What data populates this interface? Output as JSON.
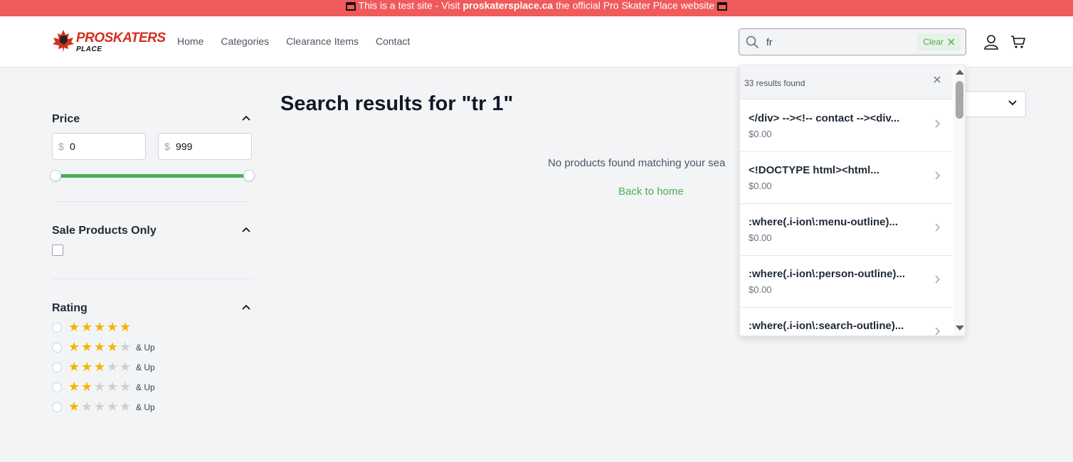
{
  "banner": {
    "prefix": "This is a test site - Visit ",
    "site": "proskatersplace.ca",
    "suffix": " the official Pro Skater Place website"
  },
  "brand": {
    "name": "PROSKATERS",
    "sub": "PLACE"
  },
  "nav": [
    "Home",
    "Categories",
    "Clearance Items",
    "Contact"
  ],
  "search": {
    "value": "fr",
    "clear_label": "Clear"
  },
  "filters": {
    "price": {
      "title": "Price",
      "currency": "$",
      "min": "0",
      "max": "999",
      "range_fraction": [
        0,
        1
      ]
    },
    "sale": {
      "title": "Sale Products Only",
      "checked": false
    },
    "rating": {
      "title": "Rating",
      "options": [
        {
          "stars": 5,
          "suffix": ""
        },
        {
          "stars": 4,
          "suffix": "& Up"
        },
        {
          "stars": 3,
          "suffix": "& Up"
        },
        {
          "stars": 2,
          "suffix": "& Up"
        },
        {
          "stars": 1,
          "suffix": "& Up"
        }
      ]
    }
  },
  "main": {
    "title": "Search results for \"tr 1\"",
    "empty_text": "No products found matching your sea",
    "back_link": "Back to home"
  },
  "dropdown": {
    "count": "33 results found",
    "results": [
      {
        "name": "</div> --><!-- contact --><div...",
        "price": "$0.00"
      },
      {
        "name": "<!DOCTYPE html><html...",
        "price": "$0.00"
      },
      {
        "name": ":where(.i-ion\\:menu-outline)...",
        "price": "$0.00"
      },
      {
        "name": ":where(.i-ion\\:person-outline)...",
        "price": "$0.00"
      },
      {
        "name": ":where(.i-ion\\:search-outline)...",
        "price": ""
      }
    ]
  },
  "colors": {
    "banner": "#f05a5a",
    "accent": "#4caf50",
    "star": "#f5b400",
    "brand_red": "#d32f1f"
  }
}
